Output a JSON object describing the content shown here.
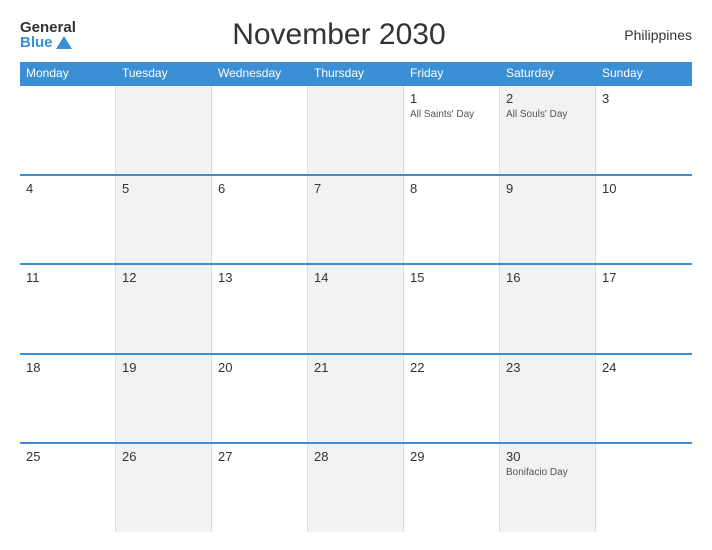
{
  "header": {
    "title": "November 2030",
    "country": "Philippines",
    "logo_general": "General",
    "logo_blue": "Blue"
  },
  "calendar": {
    "days_of_week": [
      "Monday",
      "Tuesday",
      "Wednesday",
      "Thursday",
      "Friday",
      "Saturday",
      "Sunday"
    ],
    "weeks": [
      [
        {
          "num": "",
          "event": "",
          "alt": false
        },
        {
          "num": "",
          "event": "",
          "alt": true
        },
        {
          "num": "",
          "event": "",
          "alt": false
        },
        {
          "num": "",
          "event": "",
          "alt": true
        },
        {
          "num": "1",
          "event": "All Saints' Day",
          "alt": false
        },
        {
          "num": "2",
          "event": "All Souls' Day",
          "alt": true
        },
        {
          "num": "3",
          "event": "",
          "alt": false
        }
      ],
      [
        {
          "num": "4",
          "event": "",
          "alt": false
        },
        {
          "num": "5",
          "event": "",
          "alt": true
        },
        {
          "num": "6",
          "event": "",
          "alt": false
        },
        {
          "num": "7",
          "event": "",
          "alt": true
        },
        {
          "num": "8",
          "event": "",
          "alt": false
        },
        {
          "num": "9",
          "event": "",
          "alt": true
        },
        {
          "num": "10",
          "event": "",
          "alt": false
        }
      ],
      [
        {
          "num": "11",
          "event": "",
          "alt": false
        },
        {
          "num": "12",
          "event": "",
          "alt": true
        },
        {
          "num": "13",
          "event": "",
          "alt": false
        },
        {
          "num": "14",
          "event": "",
          "alt": true
        },
        {
          "num": "15",
          "event": "",
          "alt": false
        },
        {
          "num": "16",
          "event": "",
          "alt": true
        },
        {
          "num": "17",
          "event": "",
          "alt": false
        }
      ],
      [
        {
          "num": "18",
          "event": "",
          "alt": false
        },
        {
          "num": "19",
          "event": "",
          "alt": true
        },
        {
          "num": "20",
          "event": "",
          "alt": false
        },
        {
          "num": "21",
          "event": "",
          "alt": true
        },
        {
          "num": "22",
          "event": "",
          "alt": false
        },
        {
          "num": "23",
          "event": "",
          "alt": true
        },
        {
          "num": "24",
          "event": "",
          "alt": false
        }
      ],
      [
        {
          "num": "25",
          "event": "",
          "alt": false
        },
        {
          "num": "26",
          "event": "",
          "alt": true
        },
        {
          "num": "27",
          "event": "",
          "alt": false
        },
        {
          "num": "28",
          "event": "",
          "alt": true
        },
        {
          "num": "29",
          "event": "",
          "alt": false
        },
        {
          "num": "30",
          "event": "Bonifacio Day",
          "alt": true
        },
        {
          "num": "",
          "event": "",
          "alt": false
        }
      ]
    ]
  }
}
